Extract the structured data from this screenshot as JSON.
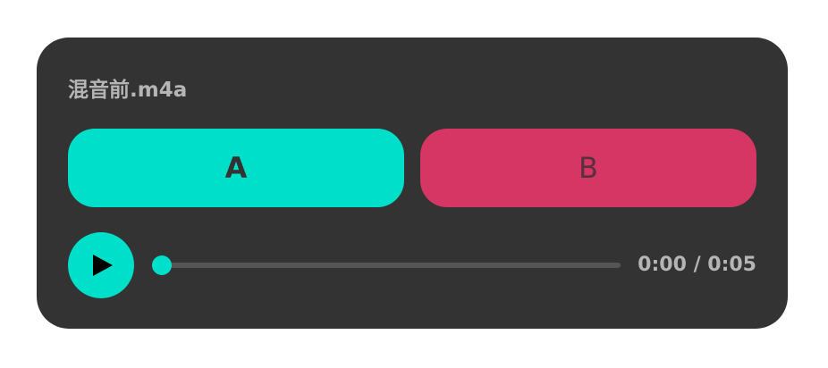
{
  "player": {
    "file_name": "混音前.m4a",
    "button_a_label": "A",
    "button_b_label": "B",
    "current_time": "0:00",
    "time_separator": " / ",
    "duration": "0:05",
    "progress": 0,
    "play_icon": "play-icon"
  },
  "colors": {
    "card_background": "#333333",
    "accent_teal": "#00dfc9",
    "accent_pink": "#d63663",
    "text_muted": "#b5b5b5",
    "track": "#555555"
  }
}
